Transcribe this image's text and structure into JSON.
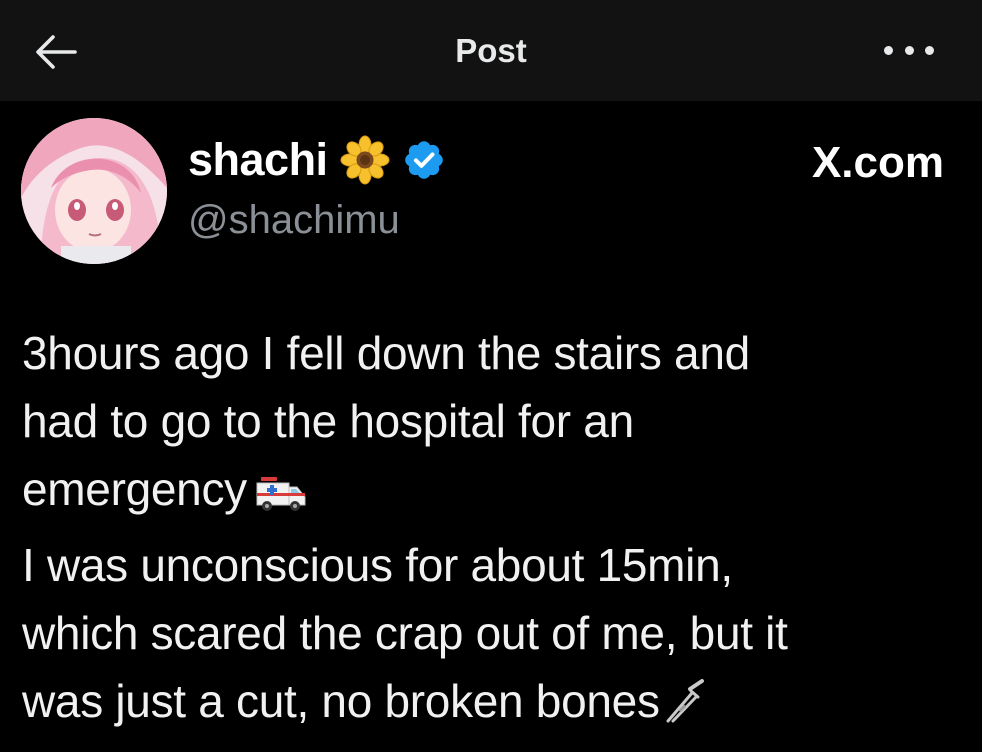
{
  "header": {
    "title": "Post",
    "back_icon": "arrow-left-icon",
    "more_icon": "more-horizontal-icon"
  },
  "author": {
    "display_name": "shachi",
    "name_emoji": "sunflower-icon",
    "verified_icon": "verified-badge-icon",
    "handle": "@shachimu",
    "avatar": "anime-avatar-pink-hair"
  },
  "brand": "X.com",
  "tweet": {
    "lines": [
      "3hours ago I fell down the stairs and",
      "had to go to the hospital for an",
      "emergency",
      "I was unconscious for about 15min,",
      "which scared the crap out of me, but it",
      "was just a cut, no broken bones"
    ],
    "emoji": [
      "ambulance-icon",
      "crutch-icon"
    ]
  },
  "colors": {
    "background": "#000000",
    "topbar": "#121212",
    "text": "#e7e9ea",
    "handle": "#8b9097",
    "verified": "#1d9bf0"
  }
}
